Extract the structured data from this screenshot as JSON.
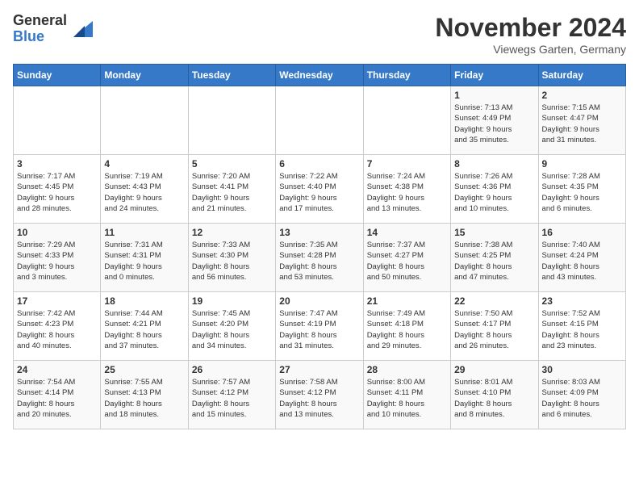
{
  "logo": {
    "general": "General",
    "blue": "Blue"
  },
  "header": {
    "month": "November 2024",
    "location": "Viewegs Garten, Germany"
  },
  "weekdays": [
    "Sunday",
    "Monday",
    "Tuesday",
    "Wednesday",
    "Thursday",
    "Friday",
    "Saturday"
  ],
  "weeks": [
    [
      {
        "day": "",
        "info": ""
      },
      {
        "day": "",
        "info": ""
      },
      {
        "day": "",
        "info": ""
      },
      {
        "day": "",
        "info": ""
      },
      {
        "day": "",
        "info": ""
      },
      {
        "day": "1",
        "info": "Sunrise: 7:13 AM\nSunset: 4:49 PM\nDaylight: 9 hours\nand 35 minutes."
      },
      {
        "day": "2",
        "info": "Sunrise: 7:15 AM\nSunset: 4:47 PM\nDaylight: 9 hours\nand 31 minutes."
      }
    ],
    [
      {
        "day": "3",
        "info": "Sunrise: 7:17 AM\nSunset: 4:45 PM\nDaylight: 9 hours\nand 28 minutes."
      },
      {
        "day": "4",
        "info": "Sunrise: 7:19 AM\nSunset: 4:43 PM\nDaylight: 9 hours\nand 24 minutes."
      },
      {
        "day": "5",
        "info": "Sunrise: 7:20 AM\nSunset: 4:41 PM\nDaylight: 9 hours\nand 21 minutes."
      },
      {
        "day": "6",
        "info": "Sunrise: 7:22 AM\nSunset: 4:40 PM\nDaylight: 9 hours\nand 17 minutes."
      },
      {
        "day": "7",
        "info": "Sunrise: 7:24 AM\nSunset: 4:38 PM\nDaylight: 9 hours\nand 13 minutes."
      },
      {
        "day": "8",
        "info": "Sunrise: 7:26 AM\nSunset: 4:36 PM\nDaylight: 9 hours\nand 10 minutes."
      },
      {
        "day": "9",
        "info": "Sunrise: 7:28 AM\nSunset: 4:35 PM\nDaylight: 9 hours\nand 6 minutes."
      }
    ],
    [
      {
        "day": "10",
        "info": "Sunrise: 7:29 AM\nSunset: 4:33 PM\nDaylight: 9 hours\nand 3 minutes."
      },
      {
        "day": "11",
        "info": "Sunrise: 7:31 AM\nSunset: 4:31 PM\nDaylight: 9 hours\nand 0 minutes."
      },
      {
        "day": "12",
        "info": "Sunrise: 7:33 AM\nSunset: 4:30 PM\nDaylight: 8 hours\nand 56 minutes."
      },
      {
        "day": "13",
        "info": "Sunrise: 7:35 AM\nSunset: 4:28 PM\nDaylight: 8 hours\nand 53 minutes."
      },
      {
        "day": "14",
        "info": "Sunrise: 7:37 AM\nSunset: 4:27 PM\nDaylight: 8 hours\nand 50 minutes."
      },
      {
        "day": "15",
        "info": "Sunrise: 7:38 AM\nSunset: 4:25 PM\nDaylight: 8 hours\nand 47 minutes."
      },
      {
        "day": "16",
        "info": "Sunrise: 7:40 AM\nSunset: 4:24 PM\nDaylight: 8 hours\nand 43 minutes."
      }
    ],
    [
      {
        "day": "17",
        "info": "Sunrise: 7:42 AM\nSunset: 4:23 PM\nDaylight: 8 hours\nand 40 minutes."
      },
      {
        "day": "18",
        "info": "Sunrise: 7:44 AM\nSunset: 4:21 PM\nDaylight: 8 hours\nand 37 minutes."
      },
      {
        "day": "19",
        "info": "Sunrise: 7:45 AM\nSunset: 4:20 PM\nDaylight: 8 hours\nand 34 minutes."
      },
      {
        "day": "20",
        "info": "Sunrise: 7:47 AM\nSunset: 4:19 PM\nDaylight: 8 hours\nand 31 minutes."
      },
      {
        "day": "21",
        "info": "Sunrise: 7:49 AM\nSunset: 4:18 PM\nDaylight: 8 hours\nand 29 minutes."
      },
      {
        "day": "22",
        "info": "Sunrise: 7:50 AM\nSunset: 4:17 PM\nDaylight: 8 hours\nand 26 minutes."
      },
      {
        "day": "23",
        "info": "Sunrise: 7:52 AM\nSunset: 4:15 PM\nDaylight: 8 hours\nand 23 minutes."
      }
    ],
    [
      {
        "day": "24",
        "info": "Sunrise: 7:54 AM\nSunset: 4:14 PM\nDaylight: 8 hours\nand 20 minutes."
      },
      {
        "day": "25",
        "info": "Sunrise: 7:55 AM\nSunset: 4:13 PM\nDaylight: 8 hours\nand 18 minutes."
      },
      {
        "day": "26",
        "info": "Sunrise: 7:57 AM\nSunset: 4:12 PM\nDaylight: 8 hours\nand 15 minutes."
      },
      {
        "day": "27",
        "info": "Sunrise: 7:58 AM\nSunset: 4:12 PM\nDaylight: 8 hours\nand 13 minutes."
      },
      {
        "day": "28",
        "info": "Sunrise: 8:00 AM\nSunset: 4:11 PM\nDaylight: 8 hours\nand 10 minutes."
      },
      {
        "day": "29",
        "info": "Sunrise: 8:01 AM\nSunset: 4:10 PM\nDaylight: 8 hours\nand 8 minutes."
      },
      {
        "day": "30",
        "info": "Sunrise: 8:03 AM\nSunset: 4:09 PM\nDaylight: 8 hours\nand 6 minutes."
      }
    ]
  ]
}
